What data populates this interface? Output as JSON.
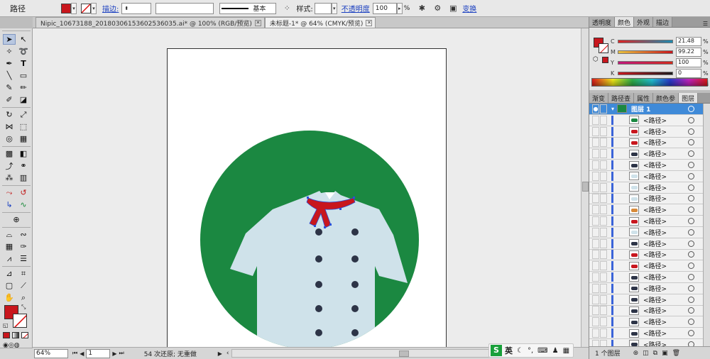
{
  "control_bar": {
    "object_type": "路径",
    "fill_color": "#c8161d",
    "stroke_label": "描边:",
    "stroke_profile": "基本",
    "style_label": "样式:",
    "opacity_label": "不透明度",
    "opacity_value": "100",
    "opacity_unit": "%",
    "transform_label": "变换"
  },
  "tabs": [
    {
      "label": "Nipic_10673188_20180306153602536035.ai* @ 100% (RGB/预览)"
    },
    {
      "label": "未标题-1* @ 64% (CMYK/预览)",
      "active": true
    }
  ],
  "artwork": {
    "circle_color": "#1b8841",
    "shirt_color": "#cfe2ea",
    "button_color": "#2d3447",
    "scarf_color": "#c8161d"
  },
  "color_panel": {
    "tabs": [
      "透明度",
      "颜色",
      "外观",
      "描边"
    ],
    "active_tab": "颜色",
    "channels": [
      {
        "label": "C",
        "value": "21.48"
      },
      {
        "label": "M",
        "value": "99.22"
      },
      {
        "label": "Y",
        "value": "100"
      },
      {
        "label": "K",
        "value": "0"
      }
    ],
    "unit": "%"
  },
  "layers_panel": {
    "tabs": [
      "渐变",
      "路径查",
      "属性",
      "颜色参",
      "图层"
    ],
    "active_tab": "图层",
    "layer_name": "图层 1",
    "item_label": "<路径>",
    "item_count": 21,
    "footer_text": "1 个图层"
  },
  "status_bar": {
    "zoom": "64%",
    "page": "1",
    "history_text": "54 次还原; 无重做"
  },
  "ime": {
    "lang": "英"
  }
}
